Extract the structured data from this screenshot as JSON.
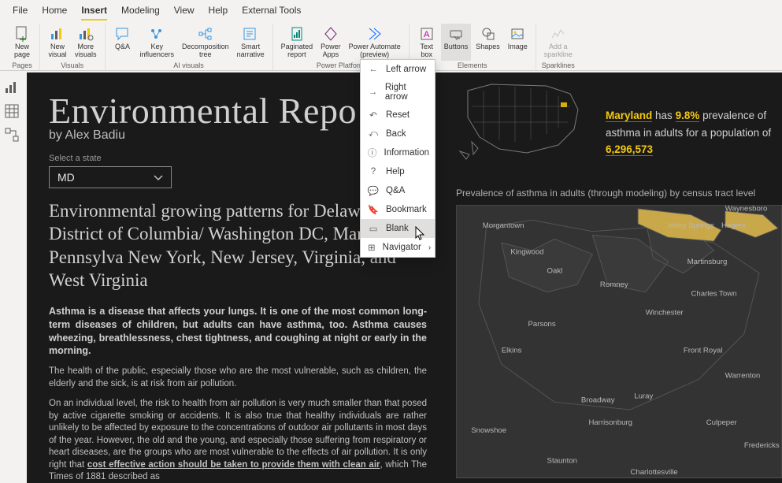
{
  "tabs": {
    "file": "File",
    "home": "Home",
    "insert": "Insert",
    "modeling": "Modeling",
    "view": "View",
    "help": "Help",
    "external": "External Tools"
  },
  "ribbon": {
    "groups": {
      "pages": {
        "label": "Pages",
        "new_page": "New\npage"
      },
      "visuals": {
        "label": "Visuals",
        "new_visual": "New\nvisual",
        "more_visuals": "More\nvisuals"
      },
      "ai": {
        "label": "AI visuals",
        "qna": "Q&A",
        "key_influencers": "Key\ninfluencers",
        "decomp": "Decomposition\ntree",
        "smart": "Smart\nnarrative"
      },
      "power_platform": {
        "label": "Power Platform",
        "paginated": "Paginated\nreport",
        "power_apps": "Power\nApps",
        "power_automate": "Power Automate\n(preview)"
      },
      "elements": {
        "label": "Elements",
        "text_box": "Text\nbox",
        "buttons": "Buttons",
        "shapes": "Shapes",
        "image": "Image"
      },
      "sparklines": {
        "label": "Sparklines",
        "add": "Add a\nsparkline"
      }
    }
  },
  "dropdown": {
    "left_arrow": "Left arrow",
    "right_arrow": "Right arrow",
    "reset": "Reset",
    "back": "Back",
    "information": "Information",
    "help": "Help",
    "qna": "Q&A",
    "bookmark": "Bookmark",
    "blank": "Blank",
    "navigator": "Navigator"
  },
  "report": {
    "title": "Environmental Repo",
    "author_prefix": "by ",
    "author": "Alex Badiu",
    "select_label": "Select a state",
    "state_value": "MD",
    "subheading": "Environmental growing patterns for Delaware, District of Columbia/ Washington DC, Maryland, Pennsylva      New York, New Jersey, Virginia, and West Virginia",
    "asthma_def": "Asthma is a disease that affects your lungs. It is one of the most common long-term diseases of children, but adults can have asthma, too. Asthma causes wheezing, breathlessness, chest tightness, and coughing at night or early in the morning.",
    "body1": "The health of the public, especially those who are the most vulnerable, such as children, the elderly and the sick, is at risk from air pollution.",
    "body2_a": "On an individual level, the risk to health from air pollution is very much smaller than that posed by active cigarette smoking or accidents. It is also true that healthy individuals are rather unlikely to be affected by exposure to the concentrations of outdoor air pollutants in most days of the year. However, the old and the young, and especially those suffering from respiratory or heart diseases, are the groups who are most vulnerable to the effects of air pollution. It is only right that ",
    "body2_u": "cost effective action should be taken to provide them with clean air",
    "body2_b": ", which The Times of 1881 described as"
  },
  "right": {
    "state_name": "Maryland",
    "has": " has ",
    "pct": "9.8%",
    "prev_text": " prevalence of asthma in adults for a population of ",
    "population": "6,296,573",
    "section_label": "Prevalence of asthma in adults (through modeling) by census tract level",
    "cities": {
      "waynesboro": "Waynesboro",
      "morgantown": "Morgantown",
      "berkeley_springs": "..keley\nSprings",
      "hagers": "Hagers",
      "kingwood": "Kingwood",
      "oakl": "Oakl",
      "martinsburg": "Martinsburg",
      "romney": "Romney",
      "charles_town": "Charles Town",
      "winchester": "Winchester",
      "parsons": "Parsons",
      "elkins": "Elkins",
      "front_royal": "Front Royal",
      "warrenton": "Warrenton",
      "broadway": "Broadway",
      "luray": "Luray",
      "harrisonburg": "Harrisonburg",
      "snowshoe": "Snowshoe",
      "culpeper": "Culpeper",
      "fredericks": "Fredericks",
      "staunton": "Staunton",
      "charlottesville": "Charlottesville"
    }
  }
}
